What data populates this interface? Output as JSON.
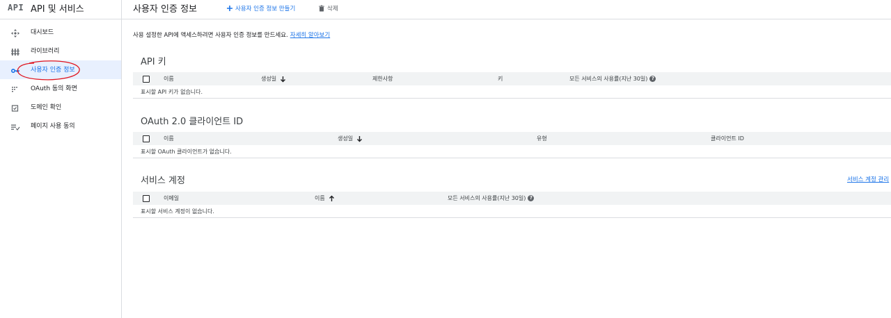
{
  "brand": {
    "logo": "API",
    "title": "API 및 서비스"
  },
  "sidebar": {
    "items": [
      {
        "label": "대시보드",
        "icon": "dashboard-icon"
      },
      {
        "label": "라이브러리",
        "icon": "library-icon"
      },
      {
        "label": "사용자 인증 정보",
        "icon": "key-icon",
        "active": true
      },
      {
        "label": "OAuth 동의 화면",
        "icon": "consent-icon"
      },
      {
        "label": "도메인 확인",
        "icon": "domain-check-icon"
      },
      {
        "label": "페이지 사용 동의",
        "icon": "page-usage-icon"
      }
    ]
  },
  "header": {
    "title": "사용자 인증 정보",
    "create_label": "사용자 인증 정보 만들기",
    "delete_label": "삭제"
  },
  "intro": {
    "text": "사용 설정한 API에 액세스하려면 사용자 인증 정보를 만드세요.",
    "link": "자세히 알아보기"
  },
  "api_keys": {
    "title": "API 키",
    "columns": [
      "이름",
      "생성일",
      "제한사항",
      "키",
      "모든 서비스의 사용률(지난 30일)"
    ],
    "empty": "표시할 API 키가 없습니다."
  },
  "oauth": {
    "title": "OAuth 2.0 클라이언트 ID",
    "columns": [
      "이름",
      "생성일",
      "유형",
      "클라이언트 ID"
    ],
    "empty": "표시할 OAuth 클라이언트가 없습니다."
  },
  "service_accounts": {
    "title": "서비스 계정",
    "manage_link": "서비스 계정 관리",
    "columns": [
      "이메일",
      "이름",
      "모든 서비스의 사용률(지난 30일)"
    ],
    "empty": "표시할 서비스 계정이 없습니다."
  },
  "colors": {
    "accent": "#1a73e8",
    "annotation": "#e0141e",
    "header_bg": "#f1f3f4"
  }
}
